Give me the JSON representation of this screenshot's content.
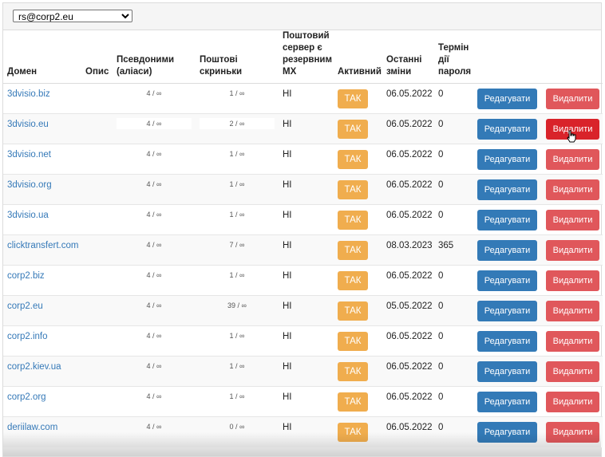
{
  "account_select": {
    "value": "rs@corp2.eu",
    "options": [
      "rs@corp2.eu"
    ]
  },
  "table": {
    "headers": {
      "domain": "Домен",
      "description": "Опис",
      "aliases": "Псевдоними (аліаси)",
      "mailboxes": "Поштові скриньки",
      "backup_mx": "Поштовий сервер є резервним MX",
      "active": "Активний",
      "last_modified": "Останні зміни",
      "password_expiry": "Термін дії пароля"
    },
    "edit_label": "Редагувати",
    "delete_label": "Видалити",
    "rows": [
      {
        "domain": "3dvisio.biz",
        "aliases": "4 / ∞",
        "mailboxes": "1 / ∞",
        "backup_mx": "НІ",
        "active": "ТАК",
        "modified": "06.05.2022",
        "expiry": "0"
      },
      {
        "domain": "3dvisio.eu",
        "aliases": "4 / ∞",
        "mailboxes": "2 / ∞",
        "backup_mx": "НІ",
        "active": "ТАК",
        "modified": "06.05.2022",
        "expiry": "0"
      },
      {
        "domain": "3dvisio.net",
        "aliases": "4 / ∞",
        "mailboxes": "1 / ∞",
        "backup_mx": "НІ",
        "active": "ТАК",
        "modified": "06.05.2022",
        "expiry": "0"
      },
      {
        "domain": "3dvisio.org",
        "aliases": "4 / ∞",
        "mailboxes": "1 / ∞",
        "backup_mx": "НІ",
        "active": "ТАК",
        "modified": "06.05.2022",
        "expiry": "0"
      },
      {
        "domain": "3dvisio.ua",
        "aliases": "4 / ∞",
        "mailboxes": "1 / ∞",
        "backup_mx": "НІ",
        "active": "ТАК",
        "modified": "06.05.2022",
        "expiry": "0"
      },
      {
        "domain": "clicktransfert.com",
        "aliases": "4 / ∞",
        "mailboxes": "7 / ∞",
        "backup_mx": "НІ",
        "active": "ТАК",
        "modified": "08.03.2023",
        "expiry": "365"
      },
      {
        "domain": "corp2.biz",
        "aliases": "4 / ∞",
        "mailboxes": "1 / ∞",
        "backup_mx": "НІ",
        "active": "ТАК",
        "modified": "06.05.2022",
        "expiry": "0"
      },
      {
        "domain": "corp2.eu",
        "aliases": "4 / ∞",
        "mailboxes": "39 / ∞",
        "backup_mx": "НІ",
        "active": "ТАК",
        "modified": "05.05.2022",
        "expiry": "0"
      },
      {
        "domain": "corp2.info",
        "aliases": "4 / ∞",
        "mailboxes": "1 / ∞",
        "backup_mx": "НІ",
        "active": "ТАК",
        "modified": "06.05.2022",
        "expiry": "0"
      },
      {
        "domain": "corp2.kiev.ua",
        "aliases": "4 / ∞",
        "mailboxes": "1 / ∞",
        "backup_mx": "НІ",
        "active": "ТАК",
        "modified": "06.05.2022",
        "expiry": "0"
      },
      {
        "domain": "corp2.org",
        "aliases": "4 / ∞",
        "mailboxes": "1 / ∞",
        "backup_mx": "НІ",
        "active": "ТАК",
        "modified": "06.05.2022",
        "expiry": "0"
      },
      {
        "domain": "deriilaw.com",
        "aliases": "4 / ∞",
        "mailboxes": "0 / ∞",
        "backup_mx": "НІ",
        "active": "ТАК",
        "modified": "06.05.2022",
        "expiry": "0"
      }
    ]
  },
  "colors": {
    "link": "#3579b8",
    "active_badge": "#f0ad4e",
    "edit_button": "#337ab7",
    "delete_button": "#e0575b",
    "delete_button_hover": "#d9232a"
  },
  "icons": {
    "cursor": "hand-pointer-icon"
  }
}
